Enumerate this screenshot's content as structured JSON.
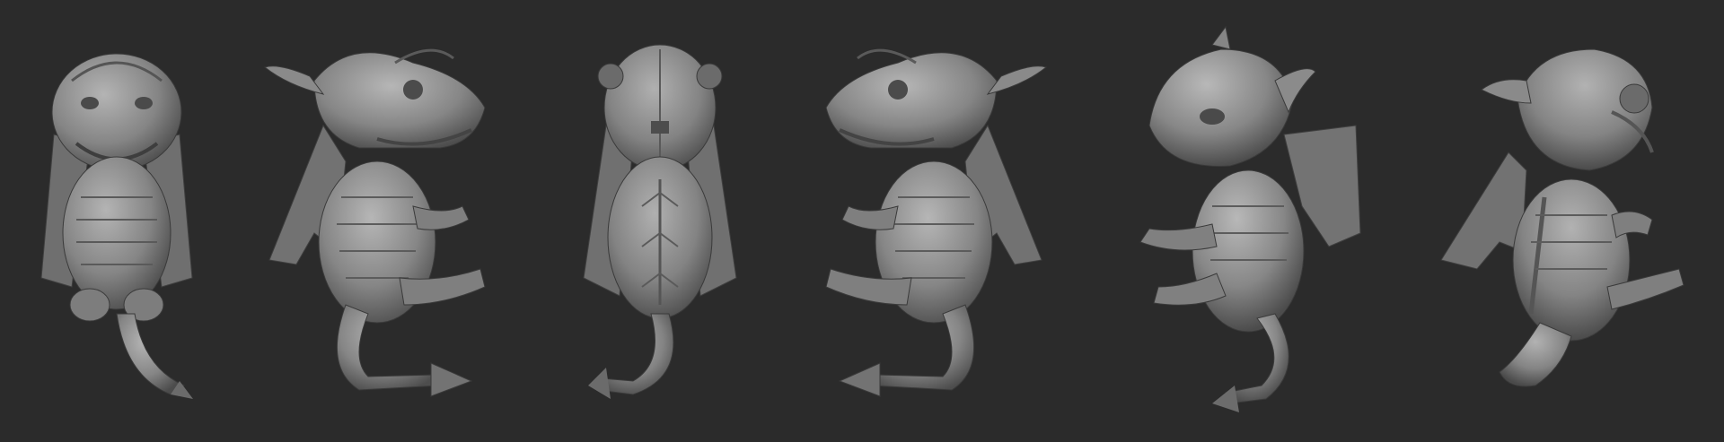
{
  "scene": {
    "background_color": "#2b2b2b",
    "subject": "dragon-sculpt",
    "material_color": "#8e8e8e",
    "views": [
      {
        "id": "front",
        "facing": "front"
      },
      {
        "id": "side-right",
        "facing": "right"
      },
      {
        "id": "back",
        "facing": "back"
      },
      {
        "id": "side-left",
        "facing": "left"
      },
      {
        "id": "three-quarter-left",
        "facing": "left"
      },
      {
        "id": "three-quarter-back",
        "facing": "back-right"
      }
    ]
  }
}
